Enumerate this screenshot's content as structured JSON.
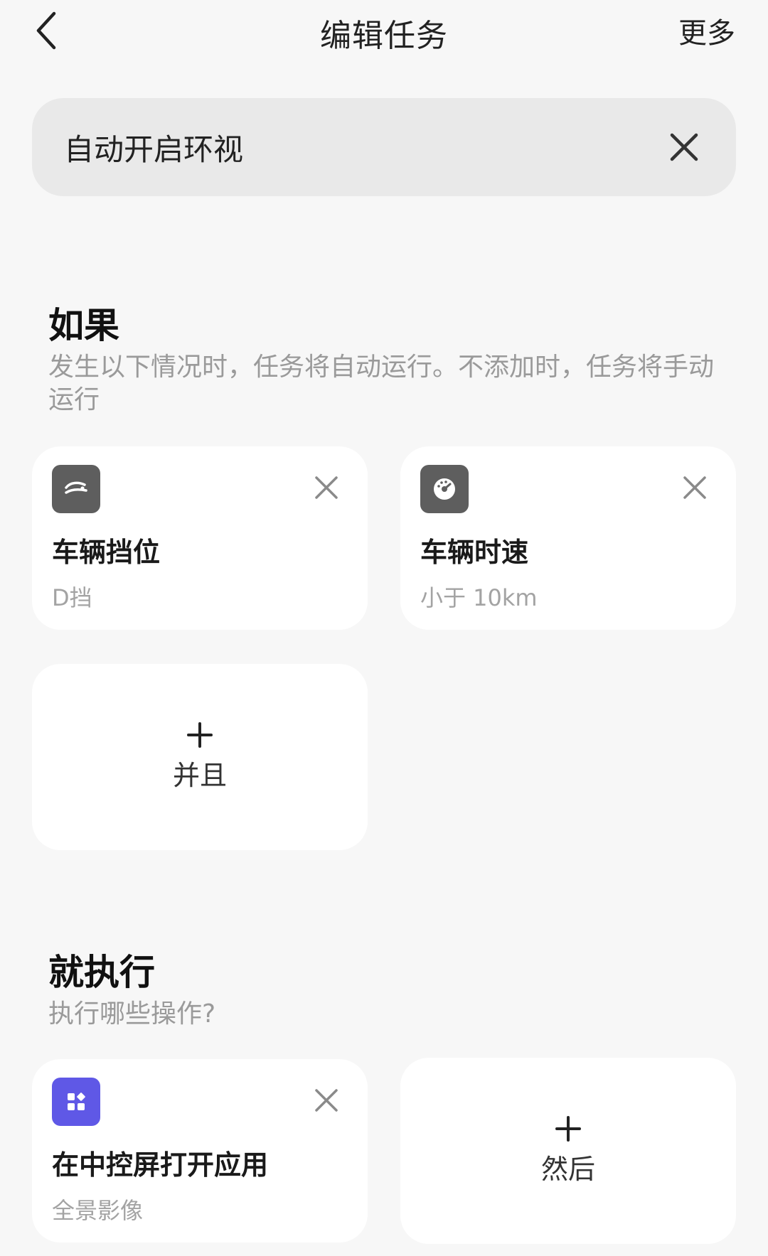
{
  "header": {
    "title": "编辑任务",
    "more_label": "更多"
  },
  "task_name": {
    "value": "自动开启环视"
  },
  "if_section": {
    "title": "如果",
    "description": "发生以下情况时，任务将自动运行。不添加时，任务将手动运行",
    "conditions": [
      {
        "label": "车辆挡位",
        "value": "D挡",
        "icon": "gear-shift-icon"
      },
      {
        "label": "车辆时速",
        "value": "小于 10km",
        "icon": "speedometer-icon"
      }
    ],
    "add_label": "并且"
  },
  "then_section": {
    "title": "就执行",
    "description": "执行哪些操作?",
    "actions": [
      {
        "label": "在中控屏打开应用",
        "value": "全景影像",
        "icon": "apps-icon"
      }
    ],
    "add_label": "然后"
  },
  "colors": {
    "background": "#f7f7f7",
    "card": "#ffffff",
    "input_bg": "#e9e9e9",
    "icon_gray": "#5e5e5e",
    "icon_purple": "#5f58e6",
    "muted_text": "#9a9a9a"
  }
}
